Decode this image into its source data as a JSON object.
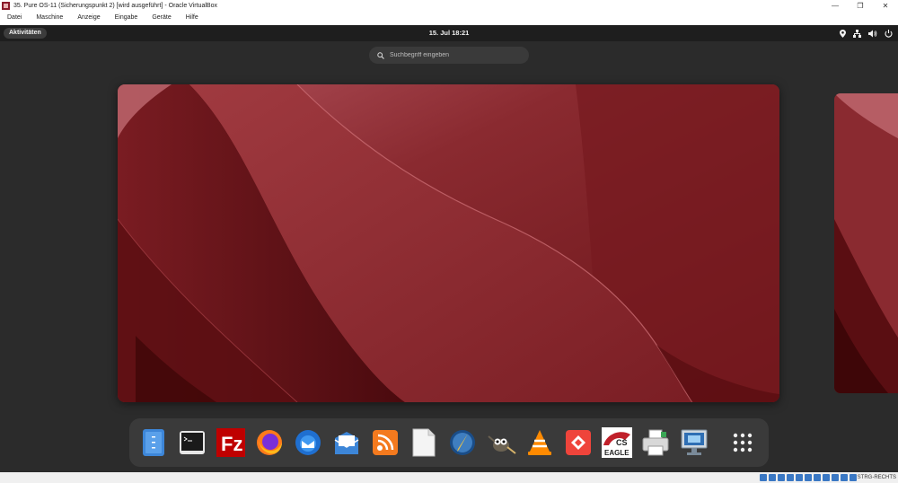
{
  "host": {
    "title": "35. Pure OS-11 (Sicherungspunkt 2) [wird ausgeführt] - Oracle VirtualBox",
    "menu": [
      "Datei",
      "Maschine",
      "Anzeige",
      "Eingabe",
      "Geräte",
      "Hilfe"
    ],
    "host_key": "STRG-RECHTS",
    "status_icons": [
      "hard-disk-icon",
      "optical-drive-icon",
      "audio-icon",
      "network-icon",
      "usb-icon",
      "shared-folder-icon",
      "display-icon",
      "recording-icon",
      "cpu-icon",
      "mouse-integration-icon",
      "keyboard-icon"
    ]
  },
  "topbar": {
    "activities_label": "Aktivitäten",
    "clock": "15. Jul  18:21",
    "tray_icons": [
      "location-icon",
      "network-wired-icon",
      "volume-icon",
      "power-icon"
    ]
  },
  "search": {
    "placeholder": "Suchbegriff eingeben"
  },
  "dock": {
    "apps": [
      "files-icon",
      "terminal-icon",
      "filezilla-icon",
      "firefox-icon",
      "thunderbird-icon",
      "mail-icon",
      "rss-reader-icon",
      "text-editor-icon",
      "inkscape-icon",
      "gimp-icon",
      "vlc-icon",
      "anydesk-icon",
      "eagle-icon",
      "printer-settings-icon",
      "remote-desktop-icon",
      "app-grid-icon"
    ]
  }
}
